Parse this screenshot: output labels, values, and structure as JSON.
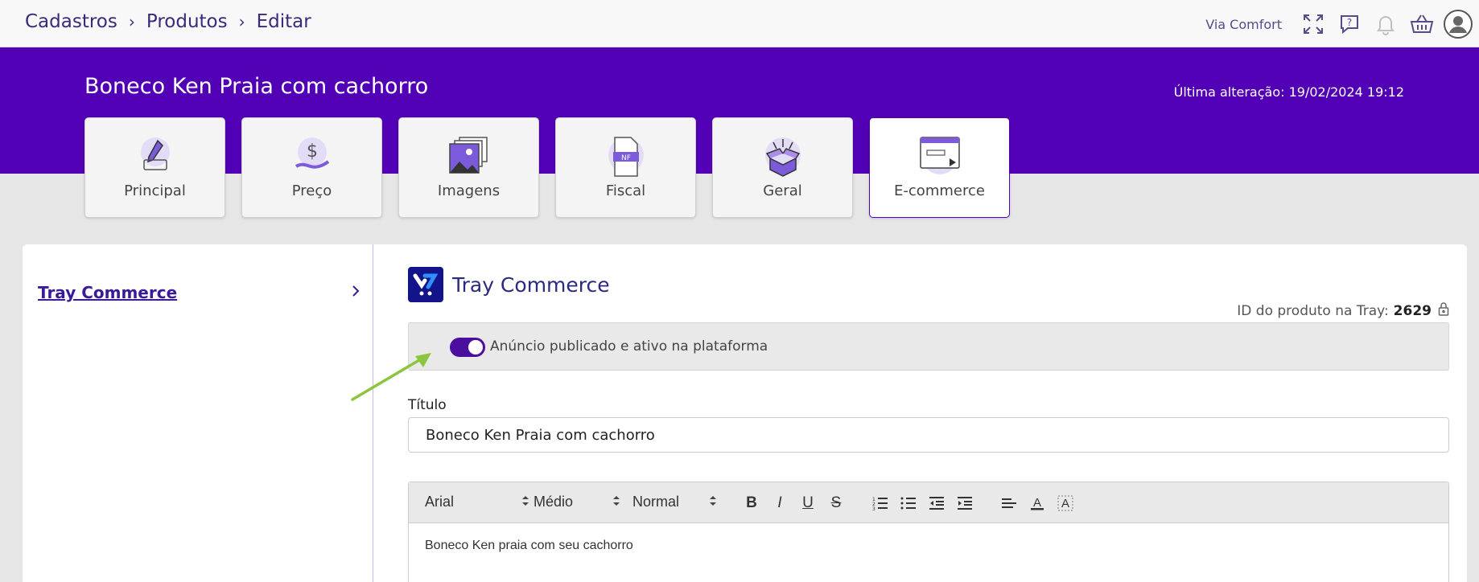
{
  "breadcrumb": {
    "items": [
      "Cadastros",
      "Produtos",
      "Editar"
    ]
  },
  "topbar": {
    "company": "Via Comfort",
    "icons": [
      "expand-icon",
      "help-chat-icon",
      "bell-icon",
      "basket-icon",
      "user-avatar-icon"
    ]
  },
  "header": {
    "product_title": "Boneco Ken Praia com cachorro",
    "last_change": "Última alteração: 19/02/2024 19:12"
  },
  "tabs": [
    {
      "label": "Principal",
      "icon": "pencil-icon"
    },
    {
      "label": "Preço",
      "icon": "money-hand-icon"
    },
    {
      "label": "Imagens",
      "icon": "images-icon"
    },
    {
      "label": "Fiscal",
      "icon": "nf-document-icon"
    },
    {
      "label": "Geral",
      "icon": "open-box-icon"
    },
    {
      "label": "E-commerce",
      "icon": "browser-window-icon",
      "active": true
    }
  ],
  "sidebar": {
    "items": [
      {
        "label": "Tray Commerce"
      }
    ]
  },
  "content": {
    "integration_title": "Tray Commerce",
    "id_label": "ID do produto na Tray:",
    "id_value": "2629",
    "toggle_label": "Anúncio publicado e ativo na plataforma",
    "toggle_on": true,
    "title_label": "Título",
    "title_value": "Boneco Ken Praia com cachorro"
  },
  "editor": {
    "font": "Arial",
    "size": "Médio",
    "style": "Normal",
    "buttons": [
      "bold",
      "italic",
      "underline",
      "strike",
      "ordered-list",
      "bullet-list",
      "outdent",
      "indent",
      "align",
      "text-color",
      "clear-format"
    ],
    "bold_glyph": "B",
    "italic_glyph": "I",
    "underline_glyph": "U",
    "strike_glyph": "S",
    "body": "Boneco Ken praia com seu cachorro"
  },
  "colors": {
    "brand": "#5200b5",
    "accent": "#4b0fa0",
    "arrow": "#8cc63f"
  }
}
